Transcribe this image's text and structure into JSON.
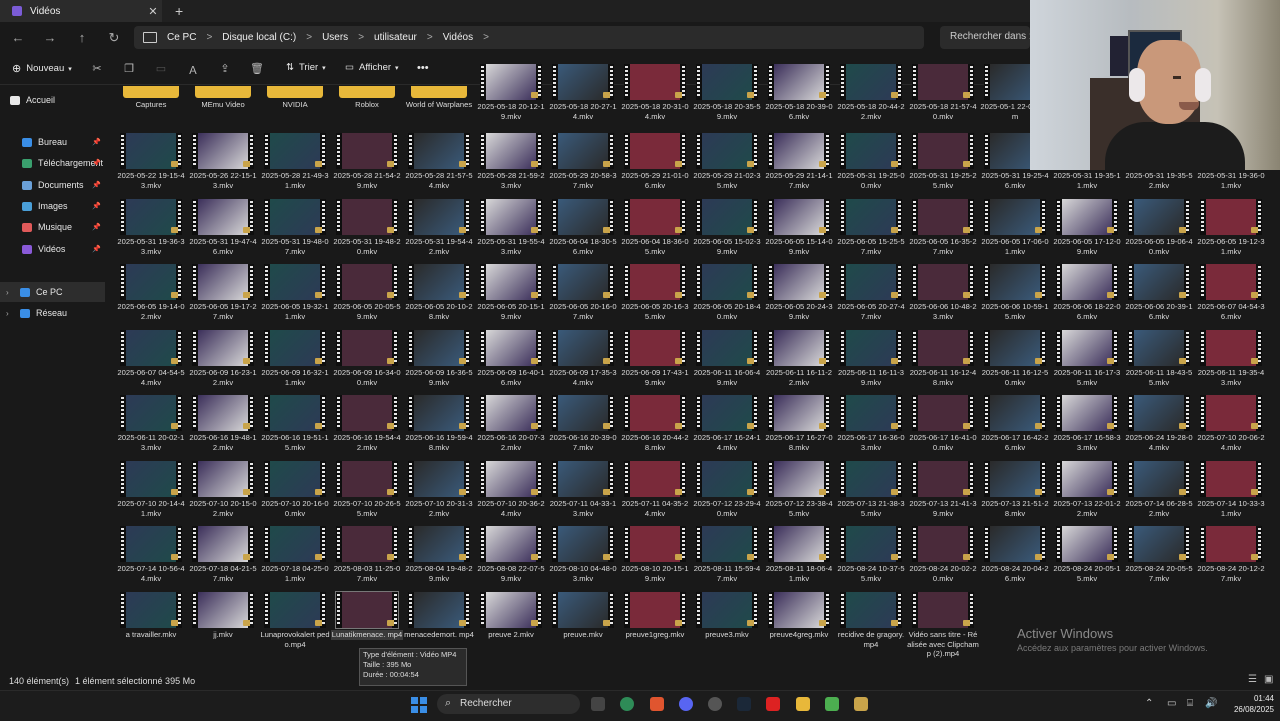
{
  "window": {
    "tab_title": "Vidéos",
    "tab_close": "✕",
    "new_tab": "+"
  },
  "nav": {
    "back_icon": "←",
    "forward_icon": "→",
    "up_icon": "↑",
    "refresh_icon": "↻",
    "breadcrumbs": [
      "Ce PC",
      "Disque local (C:)",
      "Users",
      "utilisateur",
      "Vidéos"
    ],
    "separator": ">",
    "search_placeholder": "Rechercher dans : V"
  },
  "toolbar": {
    "new_label": "Nouveau",
    "sort_label": "Trier",
    "view_label": "Afficher",
    "more_label": "•••"
  },
  "sidebar": {
    "quick": [
      {
        "label": "Accueil",
        "icon": "home-icon",
        "color": "#e8e8e8"
      },
      {
        "label": "Bureau",
        "icon": "desktop-icon",
        "color": "#3a8ee6"
      },
      {
        "label": "Téléchargement",
        "icon": "download-icon",
        "color": "#3aa06e"
      },
      {
        "label": "Documents",
        "icon": "documents-icon",
        "color": "#6aa0d8"
      },
      {
        "label": "Images",
        "icon": "images-icon",
        "color": "#4a9fd8"
      },
      {
        "label": "Musique",
        "icon": "music-icon",
        "color": "#e05a5a"
      },
      {
        "label": "Vidéos",
        "icon": "videos-icon",
        "color": "#8a5ad8"
      }
    ],
    "tree": [
      {
        "label": "Ce PC",
        "icon": "pc-icon",
        "color": "#3a8ee6",
        "selected": true
      },
      {
        "label": "Réseau",
        "icon": "network-icon",
        "color": "#3a8ee6",
        "selected": false
      }
    ]
  },
  "files": {
    "folders": [
      "Captures",
      "MEmu Video",
      "NVIDIA",
      "Roblox",
      "World of Warplanes"
    ],
    "top_videos": [
      "2025-05-18 20-12-19.mkv",
      "2025-05-18 20-27-14.mkv",
      "2025-05-18 20-31-04.mkv",
      "2025-05-18 20-35-59.mkv",
      "2025-05-18 20-39-06.mkv",
      "2025-05-18 20-44-22.mkv",
      "2025-05-18 21-57-40.mkv",
      "2025-05-1 22-02-07.m"
    ],
    "rows": [
      [
        "2025-05-22 19-15-43.mkv",
        "2025-05-26 22-15-13.mkv",
        "2025-05-28 21-49-31.mkv",
        "2025-05-28 21-54-29.mkv",
        "2025-05-28 21-57-54.mkv",
        "2025-05-28 21-59-23.mkv",
        "2025-05-29 20-58-37.mkv",
        "2025-05-29 21-01-06.mkv",
        "2025-05-29 21-02-35.mkv",
        "2025-05-29 21-14-17.mkv",
        "2025-05-31 19-25-00.mkv",
        "2025-05-31 19-25-25.mkv",
        "2025-05-31 19-25-46.mkv",
        "2025-05-31 19-35-11.mkv",
        "2025-05-31 19-35-52.mkv",
        "2025-05-31 19-36-01.mkv"
      ],
      [
        "2025-05-31 19-36-33.mkv",
        "2025-05-31 19-47-46.mkv",
        "2025-05-31 19-48-07.mkv",
        "2025-05-31 19-48-20.mkv",
        "2025-05-31 19-54-42.mkv",
        "2025-05-31 19-55-43.mkv",
        "2025-06-04 18-30-56.mkv",
        "2025-06-04 18-36-05.mkv",
        "2025-06-05 15-02-39.mkv",
        "2025-06-05 15-14-09.mkv",
        "2025-06-05 15-25-57.mkv",
        "2025-06-05 16-35-27.mkv",
        "2025-06-05 17-06-01.mkv",
        "2025-06-05 17-12-09.mkv",
        "2025-06-05 19-06-40.mkv",
        "2025-06-05 19-12-31.mkv"
      ],
      [
        "2025-06-05 19-14-02.mkv",
        "2025-06-05 19-17-27.mkv",
        "2025-06-05 19-32-11.mkv",
        "2025-06-05 20-05-59.mkv",
        "2025-06-05 20-10-28.mkv",
        "2025-06-05 20-15-19.mkv",
        "2025-06-05 20-16-07.mkv",
        "2025-06-05 20-16-35.mkv",
        "2025-06-05 20-18-40.mkv",
        "2025-06-05 20-24-39.mkv",
        "2025-06-05 20-27-47.mkv",
        "2025-06-06 10-48-23.mkv",
        "2025-06-06 10-59-15.mkv",
        "2025-06-06 18-22-06.mkv",
        "2025-06-06 20-39-16.mkv",
        "2025-06-07 04-54-36.mkv"
      ],
      [
        "2025-06-07 04-54-54.mkv",
        "2025-06-09 16-23-12.mkv",
        "2025-06-09 16-32-11.mkv",
        "2025-06-09 16-34-00.mkv",
        "2025-06-09 16-36-59.mkv",
        "2025-06-09 16-40-16.mkv",
        "2025-06-09 17-35-34.mkv",
        "2025-06-09 17-43-19.mkv",
        "2025-06-11 16-06-49.mkv",
        "2025-06-11 16-11-22.mkv",
        "2025-06-11 16-11-39.mkv",
        "2025-06-11 16-12-48.mkv",
        "2025-06-11 16-12-50.mkv",
        "2025-06-11 16-17-35.mkv",
        "2025-06-11 18-43-55.mkv",
        "2025-06-11 19-35-43.mkv"
      ],
      [
        "2025-06-11 20-02-13.mkv",
        "2025-06-16 19-48-12.mkv",
        "2025-06-16 19-51-15.mkv",
        "2025-06-16 19-54-42.mkv",
        "2025-06-16 19-59-48.mkv",
        "2025-06-16 20-07-32.mkv",
        "2025-06-16 20-39-07.mkv",
        "2025-06-16 20-44-28.mkv",
        "2025-06-17 16-24-14.mkv",
        "2025-06-17 16-27-08.mkv",
        "2025-06-17 16-36-03.mkv",
        "2025-06-17 16-41-00.mkv",
        "2025-06-17 16-42-26.mkv",
        "2025-06-17 16-58-33.mkv",
        "2025-06-24 19-28-04.mkv",
        "2025-07-10 20-06-24.mkv"
      ],
      [
        "2025-07-10 20-14-41.mkv",
        "2025-07-10 20-15-02.mkv",
        "2025-07-10 20-16-00.mkv",
        "2025-07-10 20-26-55.mkv",
        "2025-07-10 20-31-32.mkv",
        "2025-07-10 20-36-24.mkv",
        "2025-07-11 04-33-13.mkv",
        "2025-07-11 04-35-24.mkv",
        "2025-07-12 23-29-40.mkv",
        "2025-07-12 23-38-45.mkv",
        "2025-07-13 21-38-35.mkv",
        "2025-07-13 21-41-39.mkv",
        "2025-07-13 21-51-28.mkv",
        "2025-07-13 22-01-22.mkv",
        "2025-07-14 06-28-52.mkv",
        "2025-07-14 10-33-31.mkv"
      ],
      [
        "2025-07-14 10-56-44.mkv",
        "2025-07-18 04-21-57.mkv",
        "2025-07-18 04-25-01.mkv",
        "2025-08-03 11-25-07.mkv",
        "2025-08-04 19-48-29.mkv",
        "2025-08-08 22-07-59.mkv",
        "2025-08-10 04-48-03.mkv",
        "2025-08-10 20-15-19.mkv",
        "2025-08-11 15-59-47.mkv",
        "2025-08-11 18-06-41.mkv",
        "2025-08-24 10-37-55.mkv",
        "2025-08-24 20-02-20.mkv",
        "2025-08-24 20-04-26.mkv",
        "2025-08-24 20-05-15.mkv",
        "2025-08-24 20-05-57.mkv",
        "2025-08-24 20-12-27.mkv"
      ],
      [
        "a travailler.mkv",
        "jj.mkv",
        "Lunaprovokalert pedo.mp4",
        "Lunatikmenace. mp4",
        "menacedemort. mp4",
        "preuve 2.mkv",
        "preuve.mkv",
        "preuve1greg.mkv",
        "preuve3.mkv",
        "preuve4greg.mkv",
        "recidive de gragory.mp4",
        "Vidéo sans titre - Réalisée avec Clipchamp (2).mp4"
      ]
    ],
    "selected_label": "Lunatikmenace. mp4"
  },
  "tooltip": {
    "type": "Type d'élément : Vidéo MP4",
    "size": "Taille : 395 Mo",
    "duration": "Durée : 00:04:54"
  },
  "watermark": {
    "title": "Activer Windows",
    "subtitle": "Accédez aux paramètres pour activer Windows."
  },
  "status": {
    "count": "140 élément(s)",
    "selection": "1 élément sélectionné 395 Mo"
  },
  "taskbar": {
    "search_label": "Rechercher",
    "time": "01:44",
    "date": "26/08/2025"
  },
  "thumb_colors": [
    "#2d3a56",
    "#3b2f5a",
    "#1f4a4a",
    "#4a2a3a",
    "#2a2a2a",
    "#d8d8d8",
    "#3a5a7a",
    "#7a2a3a"
  ]
}
